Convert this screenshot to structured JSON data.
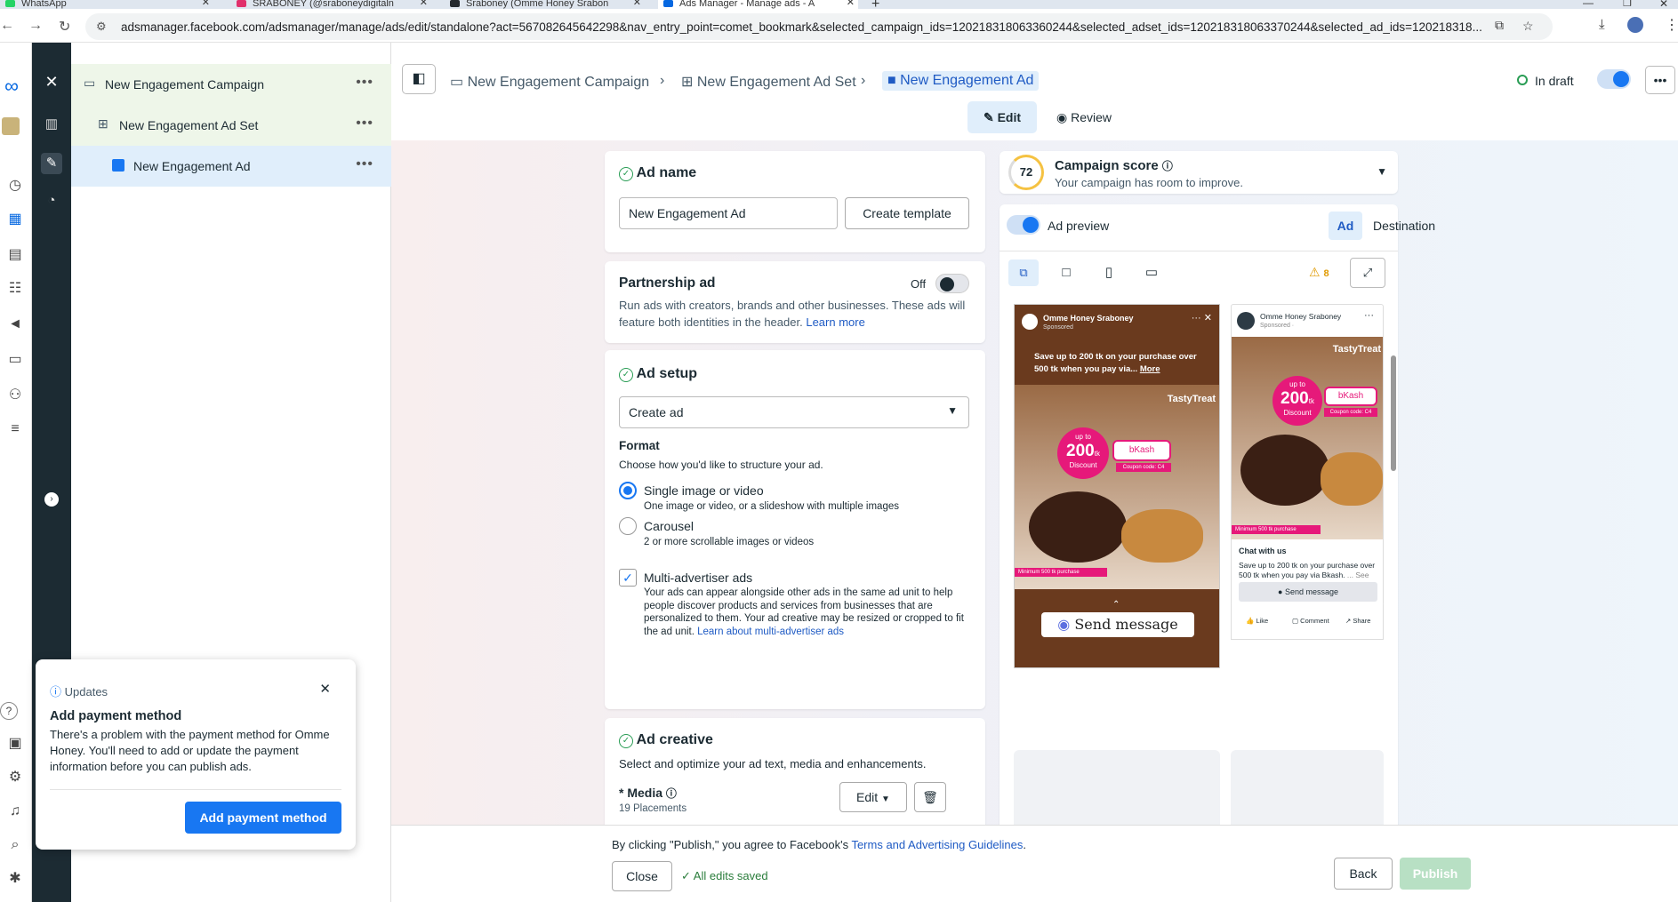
{
  "browser": {
    "tabs": [
      {
        "title": "WhatsApp",
        "color": "#25d366"
      },
      {
        "title": "SRABONEY (@sraboneydigitaln",
        "color": "#e1306c"
      },
      {
        "title": "Sraboney (Omme Honey Srabon",
        "color": "#24292f"
      },
      {
        "title": "Ads Manager - Manage ads - A",
        "color": "#0668e1"
      }
    ],
    "url": "adsmanager.facebook.com/adsmanager/manage/ads/edit/standalone?act=567082645642298&nav_entry_point=comet_bookmark&selected_campaign_ids=120218318063360244&selected_adset_ids=120218318063370244&selected_ad_ids=120218318..."
  },
  "tree": {
    "campaign": "New Engagement Campaign",
    "adset": "New Engagement Ad Set",
    "ad": "New Engagement Ad"
  },
  "header": {
    "crumbs": [
      "New Engagement Campaign",
      "New Engagement Ad Set",
      "New Engagement Ad"
    ],
    "status": "In draft",
    "edit": "Edit",
    "review": "Review"
  },
  "adname": {
    "title": "Ad name",
    "value": "New Engagement Ad",
    "template_btn": "Create template"
  },
  "partnership": {
    "title": "Partnership ad",
    "toggle": "Off",
    "desc": "Run ads with creators, brands and other businesses. These ads will feature both identities in the header.",
    "link": "Learn more"
  },
  "setup": {
    "title": "Ad setup",
    "select": "Create ad",
    "format_title": "Format",
    "format_desc": "Choose how you'd like to structure your ad.",
    "opt1": "Single image or video",
    "opt1_desc": "One image or video, or a slideshow with multiple images",
    "opt2": "Carousel",
    "opt2_desc": "2 or more scrollable images or videos",
    "multi": "Multi-advertiser ads",
    "multi_desc": "Your ads can appear alongside other ads in the same ad unit to help people discover products and services from businesses that are personalized to them. Your ad creative may be resized or cropped to fit the ad unit.",
    "multi_link": "Learn about multi-advertiser ads"
  },
  "creative": {
    "title": "Ad creative",
    "desc": "Select and optimize your ad text, media and enhancements.",
    "media": "* Media",
    "placements": "19 Placements",
    "edit": "Edit"
  },
  "score": {
    "value": "72",
    "title": "Campaign score",
    "desc": "Your campaign has room to improve."
  },
  "preview": {
    "label": "Ad preview",
    "tab_ad": "Ad",
    "tab_dest": "Destination",
    "warnings": "8",
    "story": {
      "page": "Omme Honey Sraboney",
      "sponsored": "Sponsored",
      "text": "Save up to 200 tk on your purchase over 500 tk when you pay via...",
      "more": "More",
      "cta": "Send message"
    },
    "feed": {
      "page": "Omme Honey Sraboney",
      "sponsored": "Sponsored · ",
      "headline": "Chat with us",
      "text": "Save up to 200 tk on your purchase over 500 tk when you pay via Bkash.",
      "more": "... See more",
      "cta": "Send message",
      "like": "Like",
      "comment": "Comment",
      "share": "Share"
    },
    "creative": {
      "brand": "TastyTreat",
      "upto": "up to",
      "amount": "200",
      "unit": "tk",
      "discount": "Discount",
      "pay": "bKash",
      "coupon": "Coupon code: C4",
      "minimum": "Minimum 500 tk purchase"
    }
  },
  "footer": {
    "terms_prefix": "By clicking \"Publish,\" you agree to Facebook's ",
    "terms_link": "Terms and Advertising Guidelines",
    "terms_suffix": ".",
    "close": "Close",
    "saved": "All edits saved",
    "back": "Back",
    "publish": "Publish"
  },
  "popup": {
    "label": "Updates",
    "title": "Add payment method",
    "body": "There's a problem with the payment method for Omme Honey. You'll need to add or update the payment information before you can publish ads.",
    "button": "Add payment method"
  }
}
